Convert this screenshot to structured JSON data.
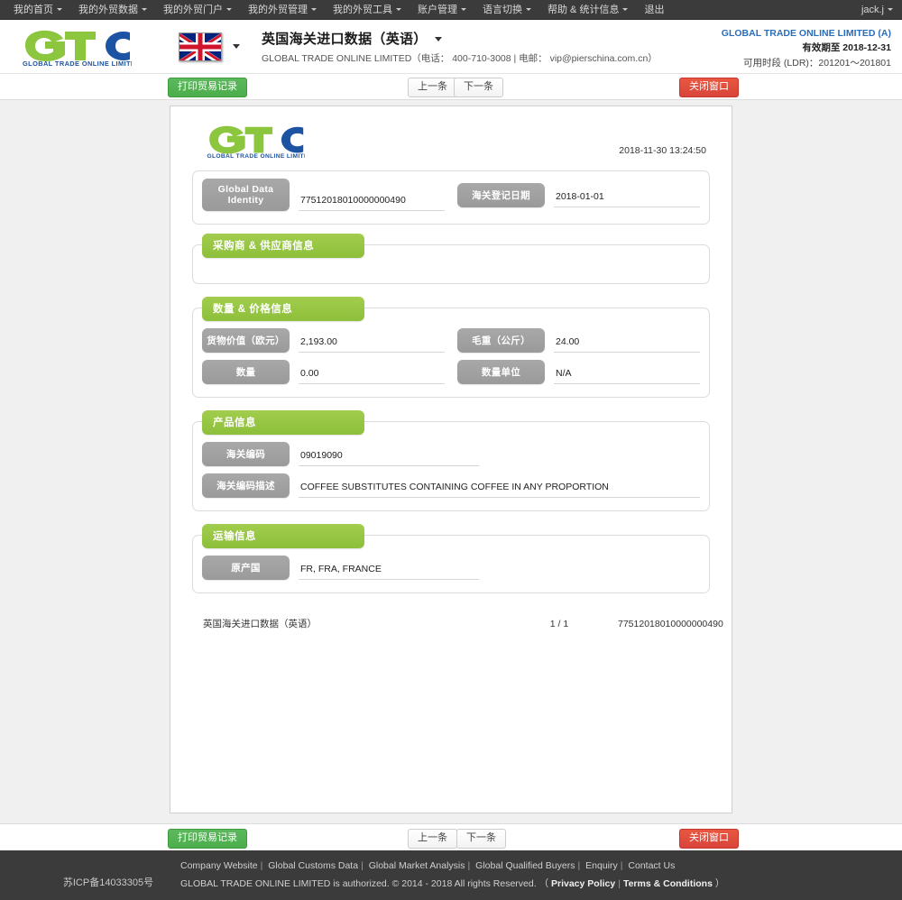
{
  "topnav": {
    "items": [
      {
        "label": "我的首页",
        "caret": true
      },
      {
        "label": "我的外贸数据",
        "caret": true
      },
      {
        "label": "我的外贸门户",
        "caret": true
      },
      {
        "label": "我的外贸管理",
        "caret": true
      },
      {
        "label": "我的外贸工具",
        "caret": true
      },
      {
        "label": "账户管理",
        "caret": true
      },
      {
        "label": "语言切换",
        "caret": true
      },
      {
        "label": "帮助 & 统计信息",
        "caret": true
      },
      {
        "label": "退出",
        "caret": false
      }
    ],
    "user": "jack.j",
    "background": "#3b3b3b"
  },
  "header": {
    "logo_text": "GLOBAL TRADE ONLINE LIMITED",
    "logo_green": "#8cc63e",
    "logo_blue": "#1c53a3",
    "flag_icon": "uk-flag-icon",
    "title": "英国海关进口数据（英语）",
    "subtitle": "GLOBAL TRADE ONLINE LIMITED（电话： 400-710-3008 | 电邮： vip@pierschina.com.cn）",
    "account_name": "GLOBAL TRADE ONLINE LIMITED (A)",
    "account_name_color": "#2a6ebb",
    "validity": "有效期至 2018-12-31",
    "ldr": "可用时段 (LDR)：201201～201801"
  },
  "toolbar": {
    "print_label": "打印贸易记录",
    "prev_label": "上一条",
    "next_label": "下一条",
    "close_label": "关闭窗口",
    "green": "#5cb85c",
    "red": "#e9573f"
  },
  "document": {
    "logo_text": "GLOBAL TRADE ONLINE LIMITED",
    "timestamp": "2018-11-30 13:24:50",
    "identity_panel": {
      "fields": [
        {
          "label": "Global Data Identity",
          "value": "77512018010000000490"
        },
        {
          "label": "海关登记日期",
          "value": "2018-01-01"
        }
      ]
    },
    "sections": [
      {
        "legend": "采购商 & 供应商信息",
        "rows": []
      },
      {
        "legend": "数量 & 价格信息",
        "rows": [
          [
            {
              "label": "货物价值（欧元）",
              "value": "2,193.00"
            },
            {
              "label": "毛重（公斤）",
              "value": "24.00"
            }
          ],
          [
            {
              "label": "数量",
              "value": "0.00"
            },
            {
              "label": "数量单位",
              "value": "N/A"
            }
          ]
        ]
      },
      {
        "legend": "产品信息",
        "rows": [
          [
            {
              "label": "海关编码",
              "value": "09019090"
            }
          ],
          [
            {
              "label": "海关编码描述",
              "value": "COFFEE SUBSTITUTES CONTAINING COFFEE IN ANY PROPORTION"
            }
          ]
        ]
      },
      {
        "legend": "运输信息",
        "rows": [
          [
            {
              "label": "原产国",
              "value": "FR, FRA, FRANCE"
            }
          ]
        ]
      }
    ],
    "footer": {
      "left": "英国海关进口数据（英语）",
      "page": "1 / 1",
      "right": "77512018010000000490"
    },
    "legend_green": "#9acd42",
    "label_grey": "#9e9e9e"
  },
  "footer": {
    "icp": "苏ICP备14033305号",
    "links": [
      "Company Website",
      "Global Customs Data",
      "Global Market Analysis",
      "Global Qualified Buyers",
      "Enquiry",
      "Contact Us"
    ],
    "copyright_prefix": "GLOBAL TRADE ONLINE LIMITED is authorized. © 2014 - 2018 All rights Reserved.",
    "copyright_open": "（",
    "privacy_label": "Privacy Policy",
    "terms_label": "Terms & Conditions",
    "copyright_close": "）",
    "background": "#3b3b3b"
  }
}
